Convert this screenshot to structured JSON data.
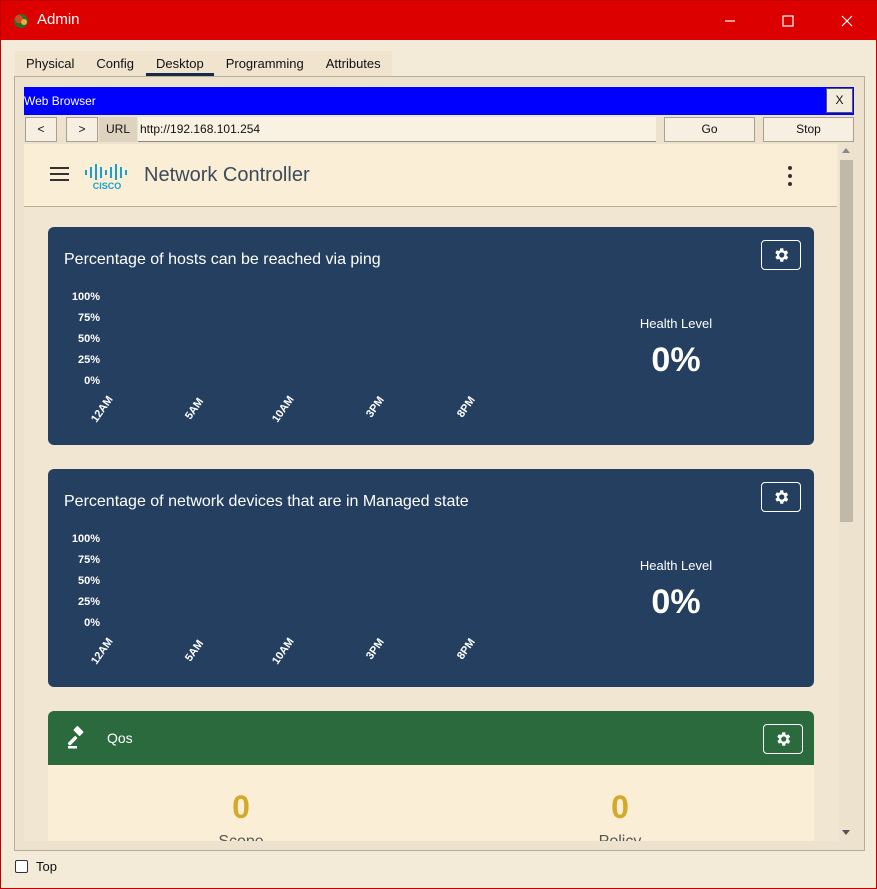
{
  "window": {
    "title": "Admin",
    "controls": {
      "minimize": "─",
      "maximize": "☐",
      "close": "✕"
    },
    "title_color": "#dd0000"
  },
  "tabs": [
    {
      "label": "Physical"
    },
    {
      "label": "Config"
    },
    {
      "label": "Desktop",
      "active": true
    },
    {
      "label": "Programming"
    },
    {
      "label": "Attributes"
    }
  ],
  "browser": {
    "title": "Web Browser",
    "close_label": "X",
    "back_label": "<",
    "forward_label": ">",
    "url_label": "URL",
    "url_value": "http://192.168.101.254",
    "go_label": "Go",
    "stop_label": "Stop"
  },
  "app": {
    "title": "Network Controller",
    "logo_text": "CISCO",
    "menu_icon": "hamburger-menu-icon",
    "more_icon": "vertical-dots-icon"
  },
  "cards": [
    {
      "title": "Percentage of hosts can be reached via ping",
      "y_ticks": [
        "100%",
        "75%",
        "50%",
        "25%",
        "0%"
      ],
      "x_ticks": [
        "12AM",
        "5AM",
        "10AM",
        "3PM",
        "8PM"
      ],
      "health_label": "Health Level",
      "health_value": "0%",
      "settings_icon": "gear-icon"
    },
    {
      "title": "Percentage of network devices that are in Managed state",
      "y_ticks": [
        "100%",
        "75%",
        "50%",
        "25%",
        "0%"
      ],
      "x_ticks": [
        "12AM",
        "5AM",
        "10AM",
        "3PM",
        "8PM"
      ],
      "health_label": "Health Level",
      "health_value": "0%",
      "settings_icon": "gear-icon"
    }
  ],
  "qos": {
    "title": "Qos",
    "icon": "gavel-icon",
    "stats": [
      {
        "value": "0",
        "label": "Scope"
      },
      {
        "value": "0",
        "label": "Policy"
      }
    ]
  },
  "footer": {
    "top_label": "Top",
    "top_checked": false
  },
  "colors": {
    "card_bg": "#243f60",
    "qos_header": "#2a6a3c",
    "stat_value": "#d4a92a",
    "browser_bar": "#0000ff"
  }
}
